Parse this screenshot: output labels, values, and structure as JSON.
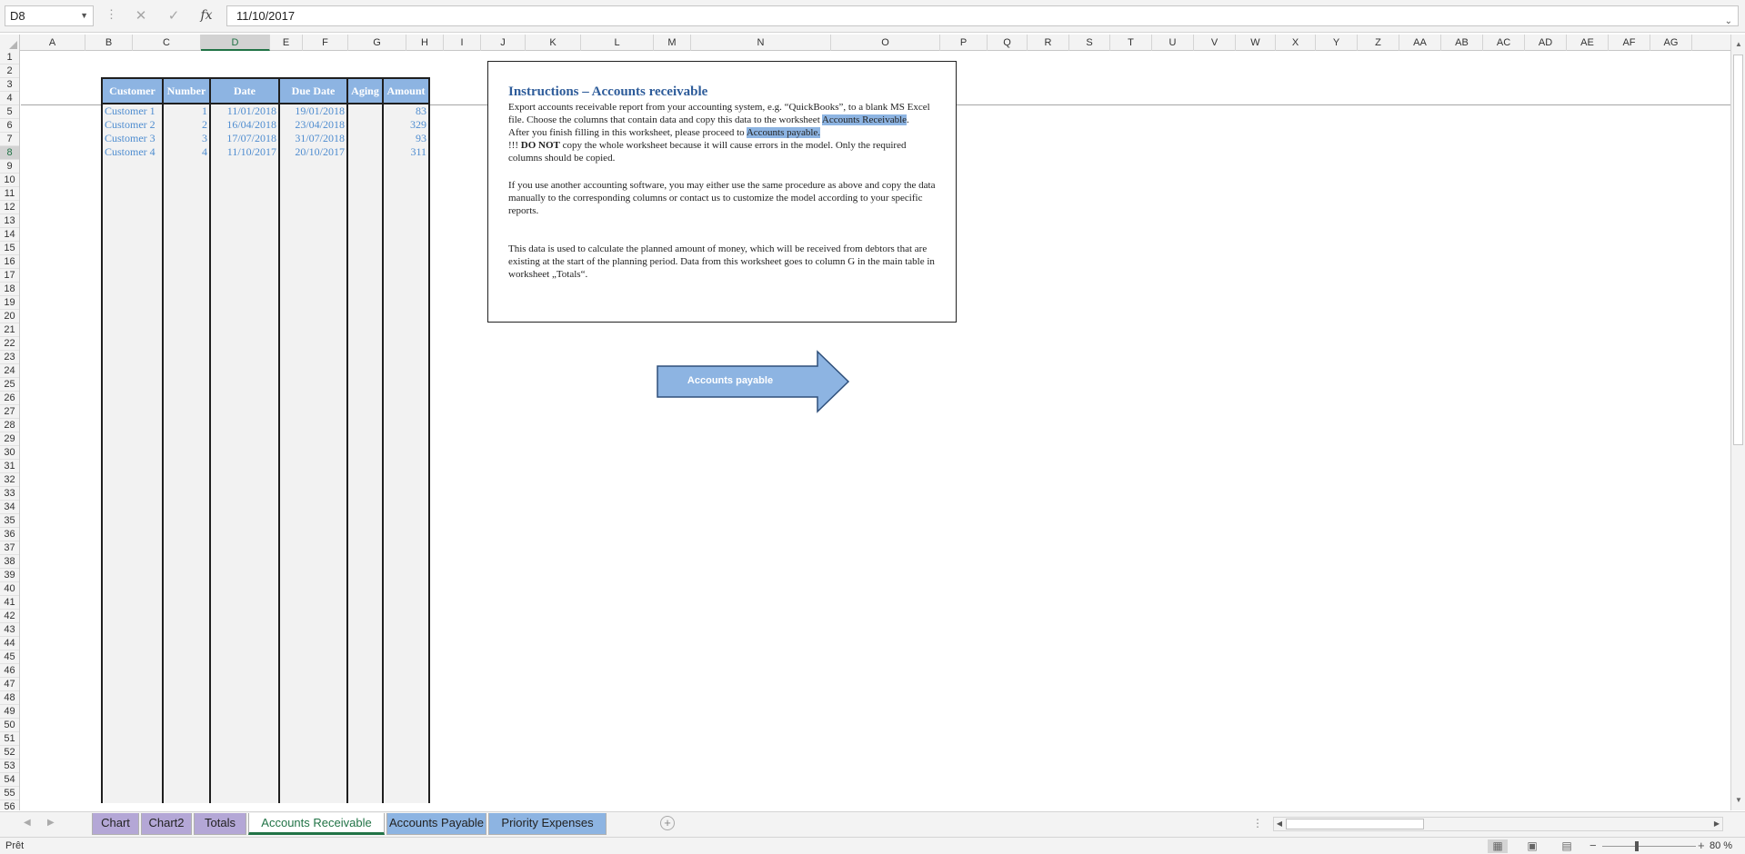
{
  "formula_bar": {
    "name_box": "D8",
    "cancel_icon": "✕",
    "enter_icon": "✓",
    "fx_label": "fx",
    "formula": "11/10/2017"
  },
  "columns": [
    "A",
    "B",
    "C",
    "D",
    "E",
    "F",
    "G",
    "H",
    "I",
    "J",
    "K",
    "L",
    "M",
    "N",
    "O",
    "P",
    "Q",
    "R",
    "S",
    "T",
    "U",
    "V",
    "W",
    "X",
    "Y",
    "Z",
    "AA",
    "AB",
    "AC",
    "AD",
    "AE",
    "AF",
    "AG"
  ],
  "selected_column": "D",
  "selected_row": 8,
  "row_count": 56,
  "table": {
    "headers": [
      "Customer",
      "Number",
      "Date",
      "Due Date",
      "Aging",
      "Amount"
    ],
    "rows": [
      {
        "customer": "Customer 1",
        "number": "1",
        "date": "11/01/2018",
        "due": "19/01/2018",
        "aging": "",
        "amount": "83"
      },
      {
        "customer": "Customer 2",
        "number": "2",
        "date": "16/04/2018",
        "due": "23/04/2018",
        "aging": "",
        "amount": "329"
      },
      {
        "customer": "Customer 3",
        "number": "3",
        "date": "17/07/2018",
        "due": "31/07/2018",
        "aging": "",
        "amount": "93"
      },
      {
        "customer": "Customer 4",
        "number": "4",
        "date": "11/10/2017",
        "due": "20/10/2017",
        "aging": "",
        "amount": "311"
      }
    ]
  },
  "instructions": {
    "title": "Instructions – Accounts receivable",
    "p1": "Export accounts receivable report from your accounting system, e.g. “QuickBooks”, to a blank MS Excel file. Choose the columns that contain data and copy this data to the worksheet ",
    "p1_link": "Accounts Receivable",
    "p1_end": ".",
    "p2": "After you finish filling in this worksheet, please proceed to ",
    "p2_link": "Accounts payable.",
    "p3_prefix": "!!! ",
    "p3_bold": "DO NOT",
    "p3_rest": " copy the whole worksheet because it will cause errors in the model. Only the required columns should be copied.",
    "p4": "If you use another accounting software, you may either use the same procedure as above and copy the data manually to the corresponding columns or contact us to customize the model according to your specific reports.",
    "p5": "This data is used to calculate the planned amount of money, which will be received from debtors that are existing at the start of the planning period. Data from this worksheet goes to column G in the main table in worksheet „Totals“."
  },
  "arrow_button": {
    "label": "Accounts payable"
  },
  "tabs": [
    {
      "label": "Chart",
      "color": "#b4a7d6",
      "active": false
    },
    {
      "label": "Chart2",
      "color": "#b4a7d6",
      "active": false
    },
    {
      "label": "Totals",
      "color": "#b4a7d6",
      "active": false
    },
    {
      "label": "Accounts Receivable",
      "color": "#ffffff",
      "active": true
    },
    {
      "label": "Accounts Payable",
      "color": "#8db4e2",
      "active": false
    },
    {
      "label": "Priority Expenses",
      "color": "#8db4e2",
      "active": false
    }
  ],
  "status": {
    "mode": "Prêt",
    "zoom": "80 %"
  },
  "colors": {
    "header_fill": "#8db4e2",
    "data_text": "#4f8dd0",
    "accent": "#217346"
  }
}
